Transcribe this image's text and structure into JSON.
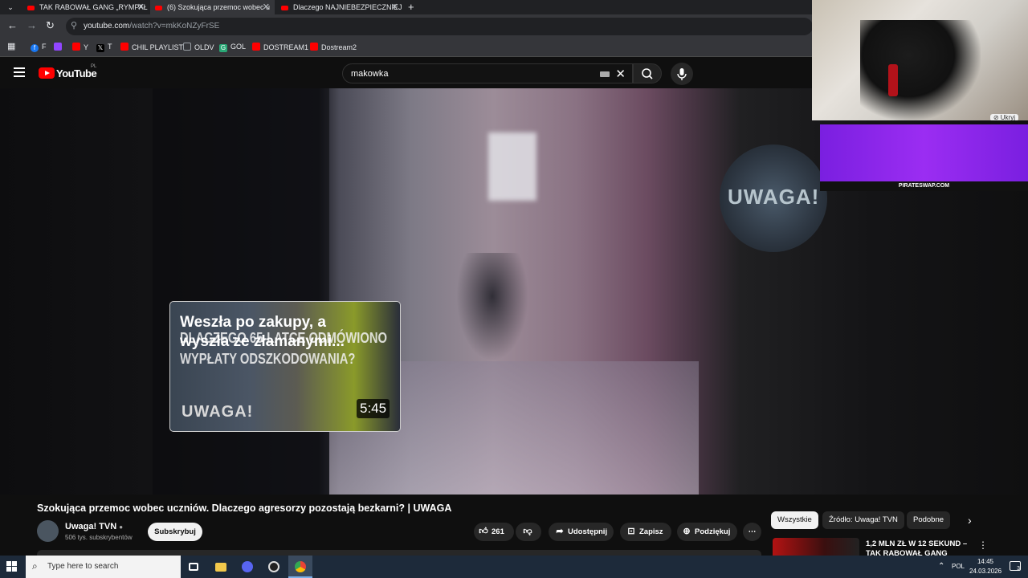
{
  "browser": {
    "tabs": [
      {
        "title": "TAK RABOWAŁ GANG „RYMPAŁ",
        "active": false
      },
      {
        "title": "(6) Szokująca przemoc wobec u",
        "active": true
      },
      {
        "title": "Dlaczego NAJNIEBEZPIECZNIEJ",
        "active": false
      }
    ],
    "url_host": "youtube.com",
    "url_path": "/watch?v=mkKoNZyFrSE",
    "bookmarks": [
      {
        "label": "F",
        "icon": "facebook-icon",
        "color": "#1877f2"
      },
      {
        "label": "",
        "icon": "twitch-icon",
        "color": "#9146ff"
      },
      {
        "label": "Y",
        "icon": "youtube-icon",
        "color": "#ff0000"
      },
      {
        "label": "T",
        "icon": "x-icon",
        "color": "#000000"
      },
      {
        "label": "CHIL PLAYLIST",
        "icon": "youtube-icon",
        "color": "#ff0000"
      },
      {
        "label": "OLDV",
        "icon": "folder-icon",
        "color": "#9aa0a6"
      },
      {
        "label": "GOL",
        "icon": "gol-icon",
        "color": "#2aa876"
      },
      {
        "label": "DOSTREAM1",
        "icon": "youtube-icon",
        "color": "#ff0000"
      },
      {
        "label": "Dostream2",
        "icon": "youtube-icon",
        "color": "#ff0000"
      }
    ]
  },
  "youtube": {
    "logo_text": "YouTube",
    "region": "PL",
    "search_query": "makowka"
  },
  "video": {
    "card_title": "Weszła po zakupy, a wyszła ze złamanymi...",
    "card_overlay_text": "DLACZEGO 65-LATCE ODMÓWIONO WYPŁATY ODSZKODOWANIA?",
    "card_brand": "UWAGA!",
    "card_duration": "5:45",
    "badge_text": "UWAGA!"
  },
  "stream": {
    "hide_label": "Ukryj",
    "banner_text": "PIRATESWAP.COM"
  },
  "info": {
    "title": "Szokująca przemoc wobec uczniów. Dlaczego agresorzy pozostają bezkarni? | UWAGA",
    "channel": "Uwaga! TVN",
    "subscribers": "506 tys. subskrybentów",
    "subscribe": "Subskrybuj",
    "likes": "261",
    "share": "Udostępnij",
    "save": "Zapisz",
    "thanks": "Podziękuj"
  },
  "sidebar": {
    "chips": [
      "Wszystkie",
      "Źródło: Uwaga! TVN",
      "Podobne"
    ],
    "recommended_title": "1,2 MLN ZŁ W 12 SEKUND – TAK RABOWAŁ GANG"
  },
  "taskbar": {
    "search_placeholder": "Type here to search",
    "language": "POL",
    "time": "14:45",
    "date": "24.03.2026",
    "notifications": "3"
  }
}
